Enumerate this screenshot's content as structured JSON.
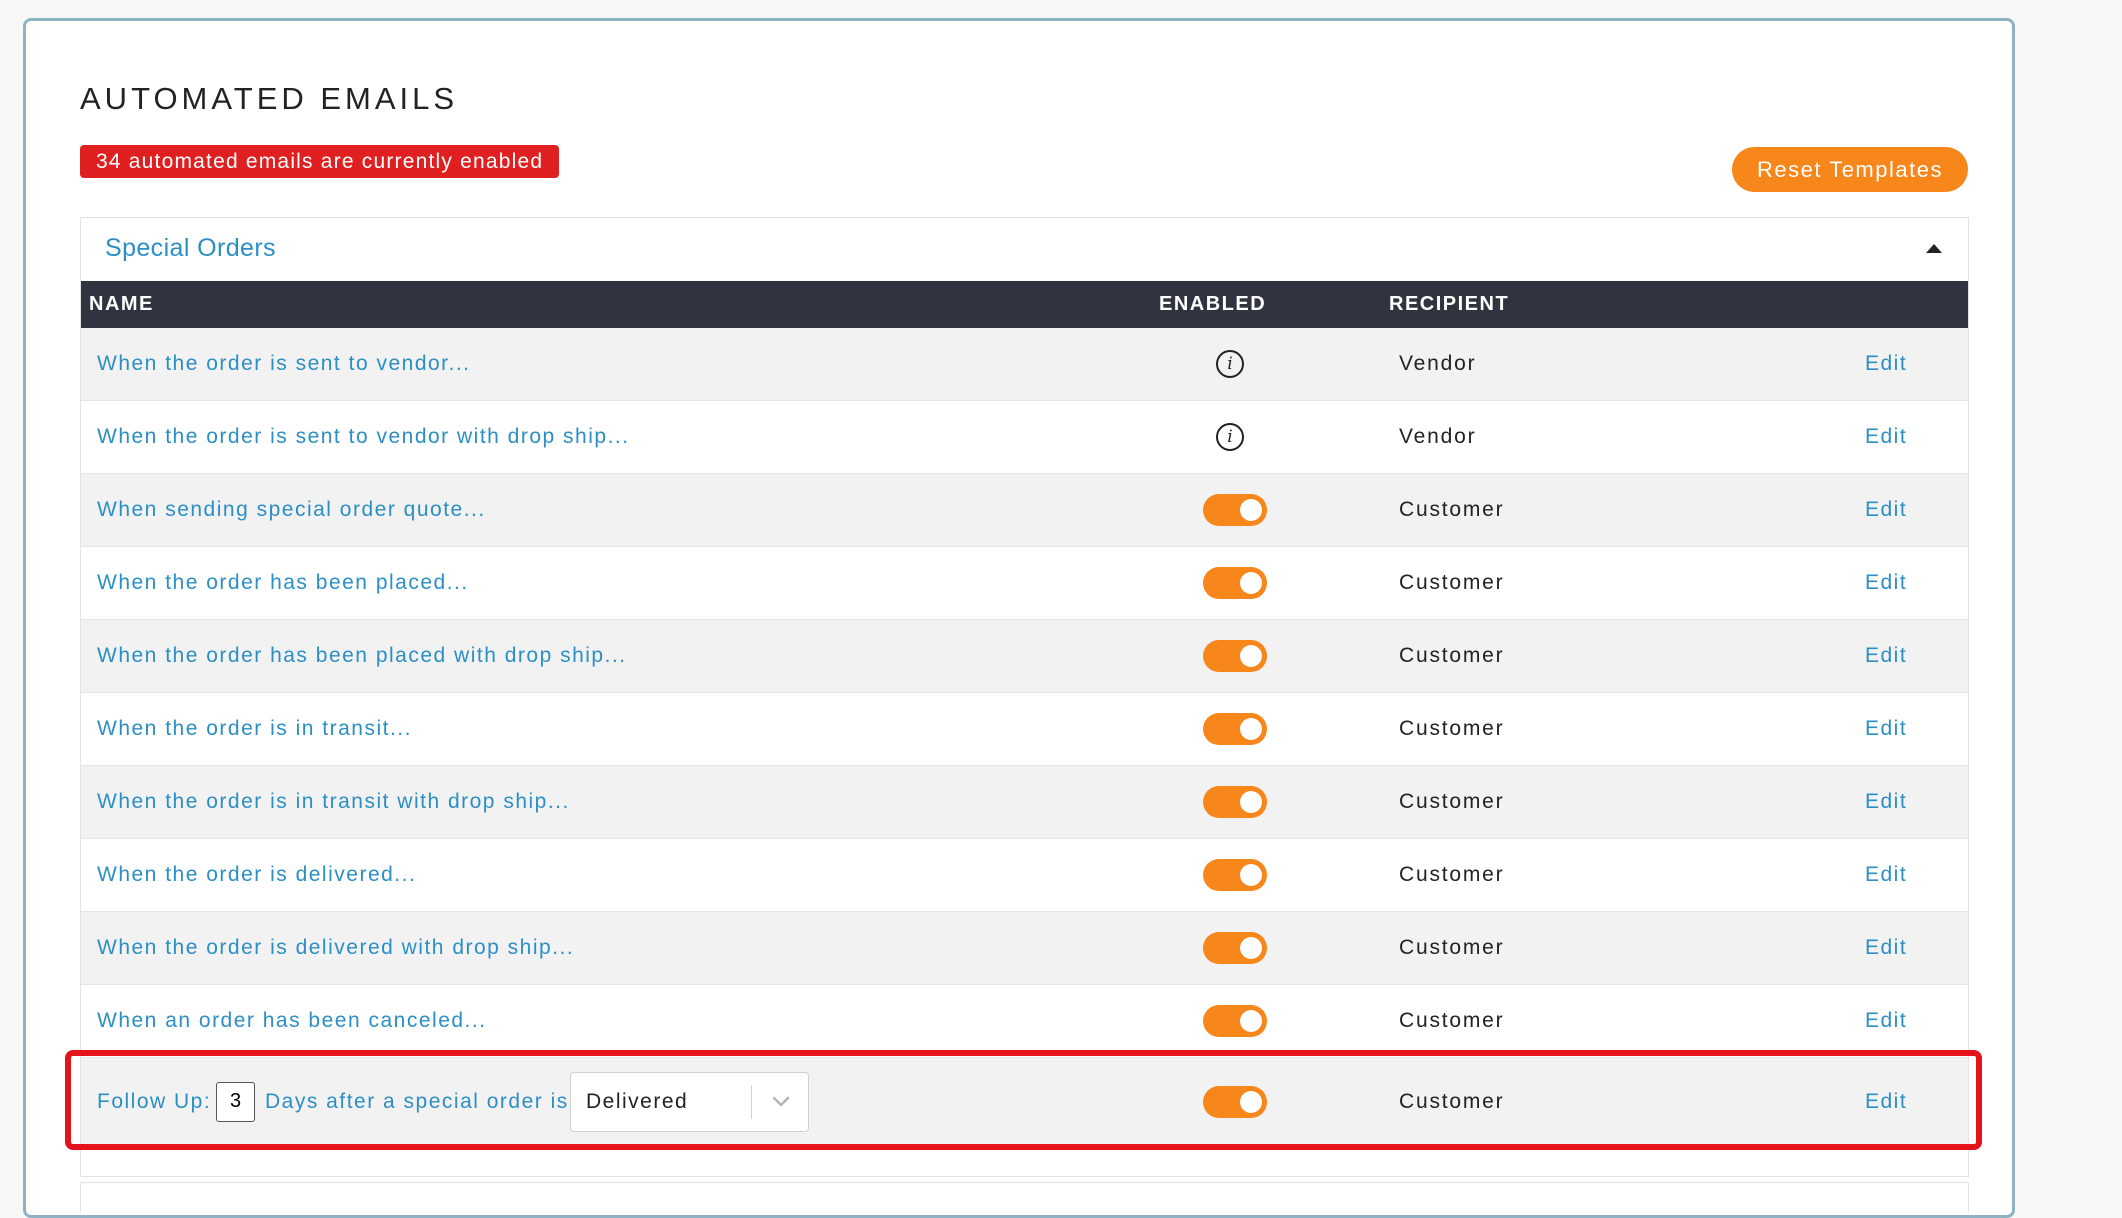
{
  "page": {
    "title": "AUTOMATED EMAILS",
    "enabled_badge": "34 automated emails are currently enabled",
    "reset_button": "Reset Templates"
  },
  "section": {
    "title": "Special Orders",
    "columns": {
      "name": "NAME",
      "enabled": "ENABLED",
      "recipient": "RECIPIENT"
    },
    "rows": [
      {
        "name": "When the order is sent to vendor...",
        "enabled": "info",
        "recipient": "Vendor",
        "action": "Edit"
      },
      {
        "name": "When the order is sent to vendor with drop ship...",
        "enabled": "info",
        "recipient": "Vendor",
        "action": "Edit"
      },
      {
        "name": "When sending special order quote...",
        "enabled": "on",
        "recipient": "Customer",
        "action": "Edit"
      },
      {
        "name": "When the order has been placed...",
        "enabled": "on",
        "recipient": "Customer",
        "action": "Edit"
      },
      {
        "name": "When the order has been placed with drop ship...",
        "enabled": "on",
        "recipient": "Customer",
        "action": "Edit"
      },
      {
        "name": "When the order is in transit...",
        "enabled": "on",
        "recipient": "Customer",
        "action": "Edit"
      },
      {
        "name": "When the order is in transit with drop ship...",
        "enabled": "on",
        "recipient": "Customer",
        "action": "Edit"
      },
      {
        "name": "When the order is delivered...",
        "enabled": "on",
        "recipient": "Customer",
        "action": "Edit"
      },
      {
        "name": "When the order is delivered with drop ship...",
        "enabled": "on",
        "recipient": "Customer",
        "action": "Edit"
      },
      {
        "name": "When an order has been canceled...",
        "enabled": "on",
        "recipient": "Customer",
        "action": "Edit"
      }
    ],
    "follow_up": {
      "prefix": "Follow Up:",
      "days": "3",
      "suffix": "Days after a special order is",
      "status": "Delivered",
      "enabled": "on",
      "recipient": "Customer",
      "action": "Edit"
    }
  },
  "colors": {
    "accent_orange": "#f7861b",
    "link_blue": "#2b8fc5",
    "badge_red": "#e02020",
    "table_header": "#2f3440",
    "highlight_red": "#e5141b"
  },
  "icons": {
    "info": "info-icon",
    "collapse": "caret-up-icon",
    "select_arrow": "chevron-down-icon"
  }
}
